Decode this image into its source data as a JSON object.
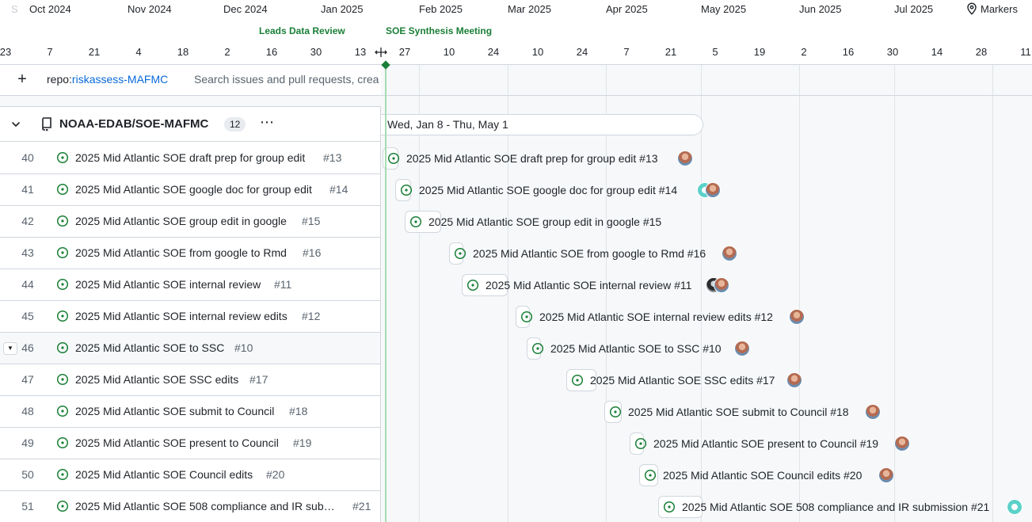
{
  "timeline": {
    "months": [
      "S",
      "Oct 2024",
      "Nov 2024",
      "Dec 2024",
      "Jan 2025",
      "Feb 2025",
      "Mar 2025",
      "Apr 2025",
      "May 2025",
      "Jun 2025",
      "Jul 2025"
    ],
    "days": [
      "23",
      "7",
      "21",
      "4",
      "18",
      "2",
      "16",
      "30",
      "13",
      "27",
      "10",
      "24",
      "10",
      "24",
      "7",
      "21",
      "5",
      "19",
      "2",
      "16",
      "30",
      "14",
      "28",
      "11"
    ],
    "markers_label": "Markers",
    "marker_labels": [
      "Leads Data Review",
      "SOE Synthesis Meeting"
    ]
  },
  "filter": {
    "repo_key": "repo:",
    "repo_value": "riskassess-MAFMC",
    "search_placeholder": "Search issues and pull requests, crea"
  },
  "group": {
    "title": "NOAA-EDAB/SOE-MAFMC",
    "count": "12",
    "more": "⋯",
    "date_range": "Wed, Jan 8 - Thu, May 1"
  },
  "rows": [
    {
      "num": "40",
      "title": "2025 Mid Atlantic SOE draft prep for group edit",
      "issue": "#13",
      "bar_label": "2025 Mid Atlantic SOE draft prep for group edit #13",
      "assignees": [
        "avatar-1"
      ]
    },
    {
      "num": "41",
      "title": "2025 Mid Atlantic SOE google doc for group edit",
      "issue": "#14",
      "bar_label": "2025 Mid Atlantic SOE google doc for group edit #14",
      "assignees": [
        "avatar-3",
        "avatar-1"
      ]
    },
    {
      "num": "42",
      "title": "2025 Mid Atlantic SOE group edit in google",
      "issue": "#15",
      "bar_label": "2025 Mid Atlantic SOE group edit in google #15",
      "assignees": []
    },
    {
      "num": "43",
      "title": "2025 Mid Atlantic SOE from google to Rmd",
      "issue": "#16",
      "bar_label": "2025 Mid Atlantic SOE from google to Rmd #16",
      "assignees": [
        "avatar-1"
      ]
    },
    {
      "num": "44",
      "title": "2025 Mid Atlantic SOE internal review",
      "issue": "#11",
      "bar_label": "2025 Mid Atlantic SOE internal review #11",
      "assignees": [
        "avatar-2",
        "avatar-1"
      ]
    },
    {
      "num": "45",
      "title": "2025 Mid Atlantic SOE internal review edits",
      "issue": "#12",
      "bar_label": "2025 Mid Atlantic SOE internal review edits #12",
      "assignees": [
        "avatar-1"
      ]
    },
    {
      "num": "46",
      "title": "2025 Mid Atlantic SOE to SSC",
      "issue": "#10",
      "bar_label": "2025 Mid Atlantic SOE to SSC #10",
      "assignees": [
        "avatar-1"
      ]
    },
    {
      "num": "47",
      "title": "2025 Mid Atlantic SOE SSC edits",
      "issue": "#17",
      "bar_label": "2025 Mid Atlantic SOE SSC edits #17",
      "assignees": [
        "avatar-1"
      ]
    },
    {
      "num": "48",
      "title": "2025 Mid Atlantic SOE submit to Council",
      "issue": "#18",
      "bar_label": "2025 Mid Atlantic SOE submit to Council #18",
      "assignees": [
        "avatar-1"
      ]
    },
    {
      "num": "49",
      "title": "2025 Mid Atlantic SOE present to Council",
      "issue": "#19",
      "bar_label": "2025 Mid Atlantic SOE present to Council #19",
      "assignees": [
        "avatar-1"
      ]
    },
    {
      "num": "50",
      "title": "2025 Mid Atlantic SOE Council edits",
      "issue": "#20",
      "bar_label": "2025 Mid Atlantic SOE Council edits #20",
      "assignees": [
        "avatar-1"
      ]
    },
    {
      "num": "51",
      "title": "2025 Mid Atlantic SOE 508 compliance and IR sub…",
      "issue": "#21",
      "bar_label": "2025 Mid Atlantic SOE 508 compliance and IR submission #21",
      "assignees": [
        "avatar-3"
      ]
    }
  ],
  "colors": {
    "open_issue": "#1a7f37",
    "link": "#0969da",
    "border": "#d0d7de"
  }
}
